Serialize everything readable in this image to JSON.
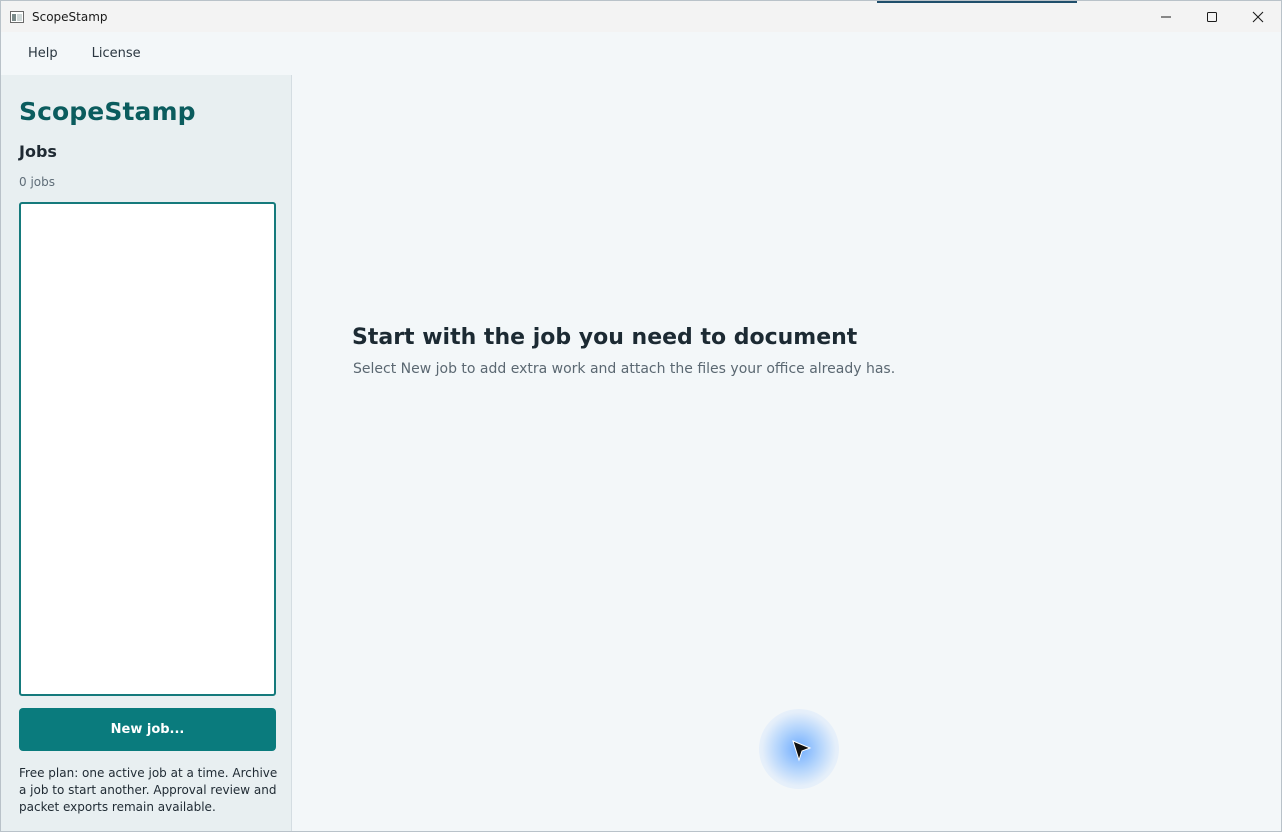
{
  "window": {
    "title": "ScopeStamp",
    "icons": {
      "app": "app-window-icon",
      "minimize": "minimize-icon",
      "maximize": "maximize-icon",
      "close": "close-icon"
    }
  },
  "menu": {
    "items": [
      {
        "label": "Help"
      },
      {
        "label": "License"
      }
    ]
  },
  "sidebar": {
    "brand": "ScopeStamp",
    "jobs_heading": "Jobs",
    "jobs_count": "0 jobs",
    "jobs": [],
    "new_job_label": "New job...",
    "plan_note": "Free plan: one active job at a time. Archive a job to start another. Approval review and packet exports remain available."
  },
  "main": {
    "empty_title": "Start with the job you need to document",
    "empty_subtitle": "Select New job to add extra work and attach the files your office already has."
  },
  "colors": {
    "brand": "#0b5c5e",
    "accent": "#0a7b7d",
    "list_border": "#157a7c",
    "sidebar_bg": "#e8eff1",
    "main_bg": "#f3f7f9"
  }
}
